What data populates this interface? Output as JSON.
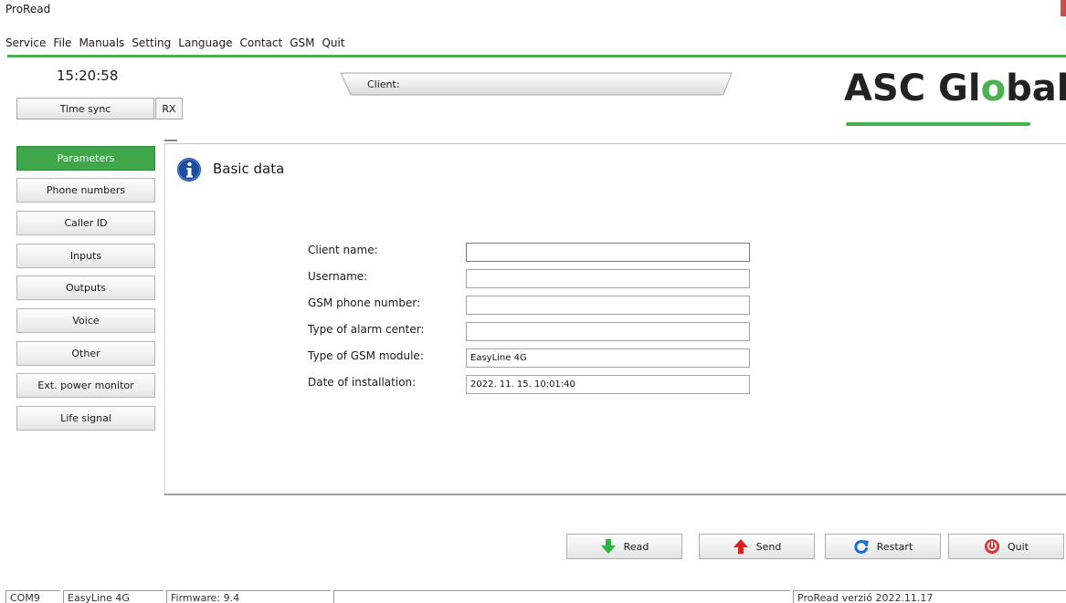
{
  "window": {
    "title": "ProRead"
  },
  "menu": [
    "Service",
    "File",
    "Manuals",
    "Setting",
    "Language",
    "Contact",
    "GSM",
    "Quit"
  ],
  "header": {
    "clock": "15:20:58",
    "time_sync_label": "Time sync",
    "rx_label": "RX",
    "client_label": "Client:",
    "logo_prefix": "ASC Gl",
    "logo_o": "o",
    "logo_suffix": "bal"
  },
  "sidebar": {
    "items": [
      {
        "label": "Parameters",
        "active": true
      },
      {
        "label": "Phone numbers",
        "active": false
      },
      {
        "label": "Caller ID",
        "active": false
      },
      {
        "label": "Inputs",
        "active": false
      },
      {
        "label": "Outputs",
        "active": false
      },
      {
        "label": "Voice",
        "active": false
      },
      {
        "label": "Other",
        "active": false
      },
      {
        "label": "Ext. power monitor",
        "active": false
      },
      {
        "label": "Life signal",
        "active": false
      }
    ]
  },
  "panel": {
    "title": "Basic data",
    "icon": "info-icon",
    "fields": [
      {
        "label": "Client name:",
        "value": ""
      },
      {
        "label": "Username:",
        "value": ""
      },
      {
        "label": "GSM phone number:",
        "value": ""
      },
      {
        "label": "Type of alarm center:",
        "value": ""
      },
      {
        "label": "Type of GSM module:",
        "value": "EasyLine 4G"
      },
      {
        "label": "Date of installation:",
        "value": "2022. 11. 15. 10:01:40"
      }
    ]
  },
  "actions": {
    "read_label": "Read",
    "send_label": "Send",
    "restart_label": "Restart",
    "quit_label": "Quit"
  },
  "status": {
    "port": "COM9",
    "device": "EasyLine 4G",
    "firmware": "Firmware: 9.4",
    "empty": "",
    "version": "ProRead verzió 2022.11.17"
  },
  "colors": {
    "accent": "#4caf50",
    "active_tab": "#3fa64a",
    "read_arrow": "#2fb344",
    "send_arrow": "#e01f1f",
    "restart_icon": "#1c6fd1",
    "quit_icon": "#d73636",
    "info_icon": "#1f4e9e"
  }
}
